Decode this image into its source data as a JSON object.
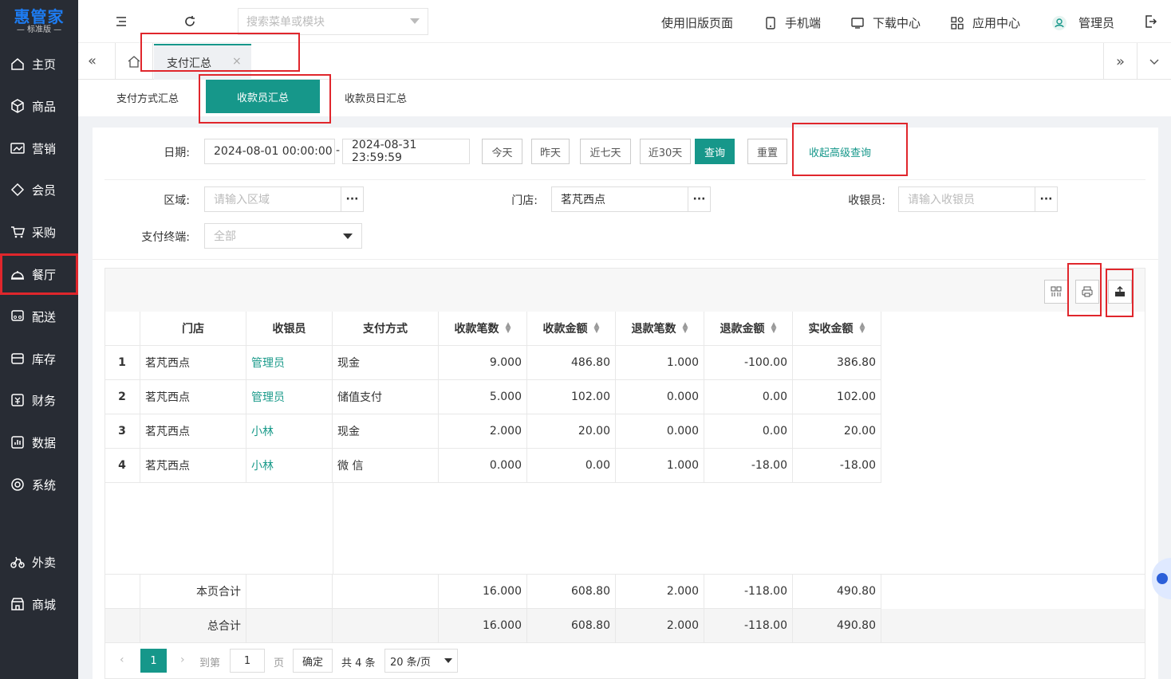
{
  "sidebar": {
    "logo": "惠管家",
    "logo_sub": "— 标准版 —",
    "items": [
      {
        "label": "主页",
        "icon": "home-icon"
      },
      {
        "label": "商品",
        "icon": "box-icon"
      },
      {
        "label": "营销",
        "icon": "chart-icon"
      },
      {
        "label": "会员",
        "icon": "diamond-icon"
      },
      {
        "label": "采购",
        "icon": "cart-icon"
      },
      {
        "label": "餐厅",
        "icon": "cloche-icon"
      },
      {
        "label": "配送",
        "icon": "truck-icon"
      },
      {
        "label": "库存",
        "icon": "inventory-icon"
      },
      {
        "label": "财务",
        "icon": "finance-icon"
      },
      {
        "label": "数据",
        "icon": "data-icon"
      },
      {
        "label": "系统",
        "icon": "settings-icon"
      },
      {
        "label": "外卖",
        "icon": "bike-icon"
      },
      {
        "label": "商城",
        "icon": "store-icon"
      }
    ]
  },
  "topbar": {
    "search_placeholder": "搜索菜单或模块",
    "old_page": "使用旧版页面",
    "mobile": "手机端",
    "download": "下载中心",
    "apps": "应用中心",
    "user": "管理员"
  },
  "tabbar": {
    "active_tab": "支付汇总",
    "close": "×"
  },
  "subtabs": {
    "items": [
      "支付方式汇总",
      "收款员汇总",
      "收款员日汇总"
    ],
    "active_index": 1
  },
  "filters": {
    "date_label": "日期:",
    "date_start": "2024-08-01 00:00:00",
    "date_sep": "-",
    "date_end": "2024-08-31 23:59:59",
    "quick": [
      "今天",
      "昨天",
      "近七天",
      "近30天"
    ],
    "query": "查询",
    "reset": "重置",
    "collapse": "收起高级查询",
    "region_label": "区域:",
    "region_placeholder": "请输入区域",
    "store_label": "门店:",
    "store_value": "茗芃西点",
    "cashier_label": "收银员:",
    "cashier_placeholder": "请输入收银员",
    "terminal_label": "支付终端:",
    "terminal_value": "全部"
  },
  "table": {
    "headers": [
      "门店",
      "收银员",
      "支付方式",
      "收款笔数",
      "收款金额",
      "退款笔数",
      "退款金额",
      "实收金额"
    ],
    "rows": [
      {
        "idx": "1",
        "store": "茗芃西点",
        "cashier": "管理员",
        "method": "现金",
        "count": "9.000",
        "amount": "486.80",
        "refund_count": "1.000",
        "refund_amount": "-100.00",
        "net": "386.80"
      },
      {
        "idx": "2",
        "store": "茗芃西点",
        "cashier": "管理员",
        "method": "储值支付",
        "count": "5.000",
        "amount": "102.00",
        "refund_count": "0.000",
        "refund_amount": "0.00",
        "net": "102.00"
      },
      {
        "idx": "3",
        "store": "茗芃西点",
        "cashier": "小林",
        "method": "现金",
        "count": "2.000",
        "amount": "20.00",
        "refund_count": "0.000",
        "refund_amount": "0.00",
        "net": "20.00"
      },
      {
        "idx": "4",
        "store": "茗芃西点",
        "cashier": "小林",
        "method": "微 信",
        "count": "0.000",
        "amount": "0.00",
        "refund_count": "1.000",
        "refund_amount": "-18.00",
        "net": "-18.00"
      }
    ],
    "page_total": {
      "label": "本页合计",
      "count": "16.000",
      "amount": "608.80",
      "refund_count": "2.000",
      "refund_amount": "-118.00",
      "net": "490.80"
    },
    "grand_total": {
      "label": "总合计",
      "count": "16.000",
      "amount": "608.80",
      "refund_count": "2.000",
      "refund_amount": "-118.00",
      "net": "490.80"
    }
  },
  "pagination": {
    "current": "1",
    "goto_label": "到第",
    "goto_value": "1",
    "page_unit": "页",
    "confirm": "确定",
    "total": "共 4 条",
    "page_size": "20 条/页"
  },
  "colors": {
    "accent": "#16978a",
    "sidebar": "#282c34",
    "highlight": "#e0262c"
  }
}
